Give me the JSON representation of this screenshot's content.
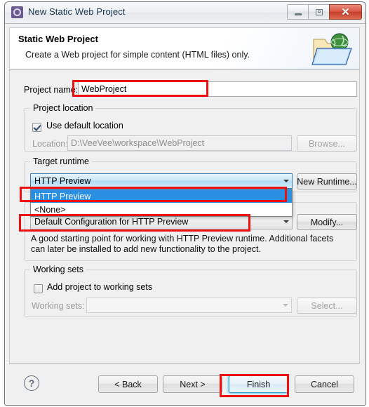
{
  "window": {
    "title": "New Static Web Project",
    "icon": "project-gear-icon",
    "minimize_label": "Minimize",
    "maximize_label": "Maximize",
    "close_label": "Close"
  },
  "banner": {
    "title": "Static Web Project",
    "description": "Create a Web project for simple content (HTML files) only.",
    "icon": "folder-globe-icon"
  },
  "project_name": {
    "label": "Project name:",
    "value": "WebProject",
    "placeholder": ""
  },
  "project_location": {
    "group_title": "Project location",
    "use_default_label": "Use default location",
    "use_default_checked": true,
    "location_label": "Location:",
    "location_value": "D:\\VeeVee\\workspace\\WebProject",
    "browse_label": "Browse...",
    "browse_enabled": false
  },
  "target_runtime": {
    "group_title": "Target runtime",
    "selected": "HTTP Preview",
    "new_runtime_label": "New Runtime...",
    "dropdown_open": true,
    "options": [
      {
        "label": "HTTP Preview",
        "selected": true
      },
      {
        "label": "<None>",
        "selected": false
      }
    ]
  },
  "configuration": {
    "selected": "Default Configuration for HTTP Preview",
    "modify_label": "Modify...",
    "description": "A good starting point for working with HTTP Preview runtime. Additional facets can later be installed to add new functionality to the project."
  },
  "working_sets": {
    "group_title": "Working sets",
    "add_label": "Add project to working sets",
    "add_checked": false,
    "working_sets_label": "Working sets:",
    "working_sets_value": "",
    "select_label": "Select...",
    "select_enabled": false
  },
  "footer": {
    "help_glyph": "?",
    "back_label": "< Back",
    "next_label": "Next >",
    "finish_label": "Finish",
    "cancel_label": "Cancel",
    "finish_focused": true
  },
  "annotations": {
    "color": "#ee1111",
    "boxes": [
      "project-name-field",
      "runtime-dropdown-item",
      "configuration-combo",
      "finish-button"
    ]
  }
}
